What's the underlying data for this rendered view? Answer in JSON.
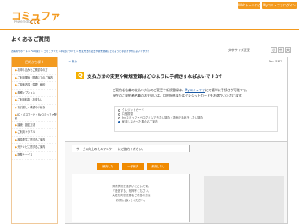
{
  "header": {
    "logo_text": "コミュファ",
    "logo_sub": "Powered by",
    "logo_ctc": "ctc",
    "button_web_login": "Webトールログイン",
    "button_mycommufa": "Myコミュファログイン"
  },
  "page_title": "よくあるご質問",
  "breadcrumb": "お客様サポート  >  FAQ検索  >  コミュファ光  >  料金について  >  支払方法の変更や新規登録はどのように手続きすればよいですか？",
  "font_size": {
    "label": "文字サイズ変更",
    "small": "小",
    "medium": "中",
    "large": "大"
  },
  "sidebar": {
    "heading": "目的から探す",
    "items": [
      "お申し込みをご検討中の方",
      "ご利用開始・開通までのご案内",
      "ご契約内容・変更・解約",
      "各種オプション",
      "ご利用料金・お支払い",
      "お引越し・移設の手続き",
      "ID・パスワード・Myコミュファ登録",
      "接続・設定方法",
      "ご利用トラブル",
      "故障発生に関するご案内",
      "光テレビに関するご案内",
      "提携サービス"
    ]
  },
  "content": {
    "back_link": "< 戻る",
    "question_number": "No：3179",
    "q_icon": "Q",
    "question": "支払方法の変更や新規登録はどのように手続きすればよいですか？",
    "answer_lines": [
      "ご契約者名義の支払い方法のご変更や新規登録は、",
      "にて簡単に手続きが可能です。",
      "現在のご契約者名義のお支払いは、口座振替またはクレジットカードをお選びいただけます。"
    ],
    "answer_link": "Myコミュファ",
    "options": [
      "クレジットカード",
      "口座振替",
      "Myコミュファへログインできない場合・書面で手続きしたい場合",
      "解決しなかった場合のご案内"
    ]
  },
  "survey": {
    "question": "サービス向上のためアンケートにご協力ください。",
    "buttons": [
      "解決した",
      "一部解決",
      "解決しない"
    ],
    "bubble_lines": [
      "解決状況を選択いただいた後、",
      "「送信する」を押下ください。",
      "大幅な内容変更をご希望の方は",
      "お問い合わせください。"
    ]
  }
}
